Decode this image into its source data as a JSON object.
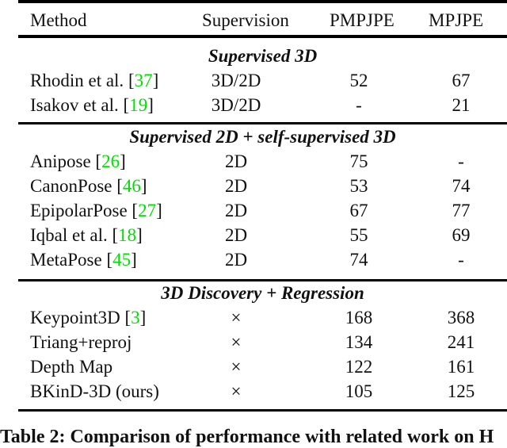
{
  "table": {
    "headers": [
      "Method",
      "Supervision",
      "PMPJPE",
      "MPJPE"
    ],
    "sections": [
      {
        "title": "Supervised 3D",
        "rows": [
          {
            "method": "Rhodin et al. ",
            "cite": "37",
            "supervision": "3D/2D",
            "pmpjpe": "52",
            "mpjpe": "67"
          },
          {
            "method": "Isakov et al. ",
            "cite": "19",
            "supervision": "3D/2D",
            "pmpjpe": "-",
            "mpjpe": "21"
          }
        ]
      },
      {
        "title": "Supervised 2D + self-supervised 3D",
        "rows": [
          {
            "method": "Anipose ",
            "cite": "26",
            "supervision": "2D",
            "pmpjpe": "75",
            "mpjpe": "-"
          },
          {
            "method": "CanonPose ",
            "cite": "46",
            "supervision": "2D",
            "pmpjpe": "53",
            "mpjpe": "74"
          },
          {
            "method": "EpipolarPose ",
            "cite": "27",
            "supervision": "2D",
            "pmpjpe": "67",
            "mpjpe": "77"
          },
          {
            "method": "Iqbal et al. ",
            "cite": "18",
            "supervision": "2D",
            "pmpjpe": "55",
            "mpjpe": "69"
          },
          {
            "method": "MetaPose ",
            "cite": "45",
            "supervision": "2D",
            "pmpjpe": "74",
            "mpjpe": "-"
          }
        ]
      },
      {
        "title": "3D Discovery + Regression",
        "rows": [
          {
            "method": "Keypoint3D ",
            "cite": "3",
            "supervision": "×",
            "pmpjpe": "168",
            "mpjpe": "368"
          },
          {
            "method": "Triang+reproj",
            "cite": "",
            "supervision": "×",
            "pmpjpe": "134",
            "mpjpe": "241"
          },
          {
            "method": "Depth Map",
            "cite": "",
            "supervision": "×",
            "pmpjpe": "122",
            "mpjpe": "161"
          },
          {
            "method": "BKinD-3D (ours)",
            "cite": "",
            "supervision": "×",
            "pmpjpe": "105",
            "mpjpe": "125"
          }
        ]
      }
    ]
  },
  "caption": "Table 2: Comparison of performance with related work on H",
  "colors": {
    "citation": "#00e000",
    "rule": "#000000"
  }
}
